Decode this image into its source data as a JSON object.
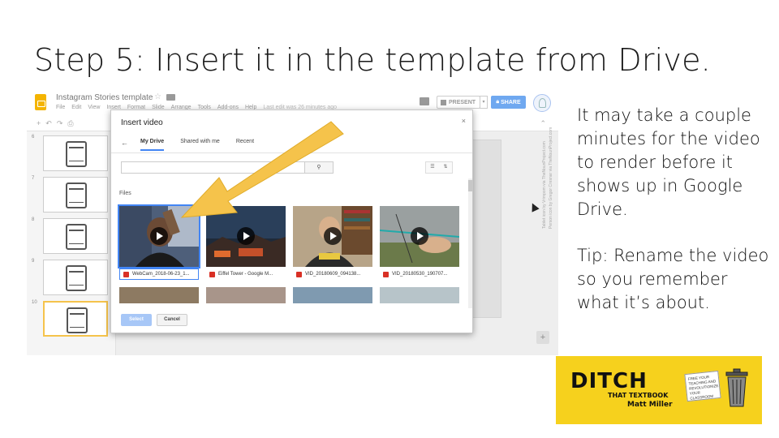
{
  "slide": {
    "title": "Step 5: Insert it in the template from Drive.",
    "side_paragraph_1": "It may take a couple minutes for the video to render before it shows up in Google Drive.",
    "side_paragraph_2": "Tip: Rename the video so you remember what it’s about."
  },
  "slides_app": {
    "doc_title": "Instagram Stories template",
    "menu": [
      "File",
      "Edit",
      "View",
      "Insert",
      "Format",
      "Slide",
      "Arrange",
      "Tools",
      "Add-ons",
      "Help"
    ],
    "last_edit": "Last edit was 26 minutes ago",
    "present_label": "PRESENT",
    "share_label": "SHARE",
    "filmstrip_numbers": [
      "6",
      "7",
      "8",
      "9",
      "10"
    ],
    "canvas_credit_1": "Tablet icon by Vrimpom via TheNounProject.com",
    "canvas_credit_2": "Person icon by Gregor Cresnar via TheNounProject.com"
  },
  "dialog": {
    "title": "Insert video",
    "close": "×",
    "back": "←",
    "tabs": [
      "My Drive",
      "Shared with me",
      "Recent"
    ],
    "active_tab": "My Drive",
    "search_button": "⚲",
    "files_label": "Files",
    "files": [
      {
        "name": "WebCam_2018-06-23_1...",
        "selected": true
      },
      {
        "name": "Eiffel Tower - Google M...",
        "selected": false
      },
      {
        "name": "VID_20180609_094138...",
        "selected": false
      },
      {
        "name": "VID_20180530_190707...",
        "selected": false
      }
    ],
    "select_label": "Select",
    "cancel_label": "Cancel"
  },
  "logo": {
    "word": "DITCH",
    "subtitle": "THAT TEXTBOOK",
    "author": "Matt Miller",
    "paper_text": "FREE YOUR TEACHING AND REVOLUTIONIZE YOUR CLASSROOM"
  },
  "colors": {
    "arrow": "#f5c34b",
    "logo_bg": "#f6d11d",
    "select_button": "#a7c7f7",
    "share_button": "#6fa8f0"
  }
}
